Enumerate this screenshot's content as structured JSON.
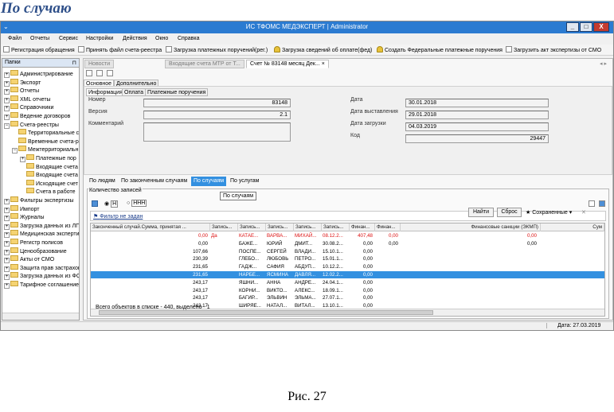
{
  "heading": "По случаю",
  "caption": "Рис. 27",
  "window": {
    "title": "ИС ТФОМС МЕДЭКСПЕРТ | Administrator",
    "app_icon": "chevron-icon",
    "btn_min": "_",
    "btn_max": "□",
    "btn_close": "X"
  },
  "menu": [
    "Файл",
    "Отчеты",
    "Сервис",
    "Настройки",
    "Действия",
    "Окно",
    "Справка"
  ],
  "toolbar": [
    "Регистрация обращения",
    "Принять файл счета-реестра",
    "Загрузка платежных поручений(рег.)",
    "Загрузка сведений об оплате(фед)",
    "Создать Федеральные платежные поручения",
    "Загрузить акт экспертизы от СМО"
  ],
  "left_panel": {
    "title": "Папки",
    "pin": "⊓",
    "items": [
      "Администрирование",
      "Экспорт",
      "Отчеты",
      "XML отчеты",
      "Справочники",
      "Ведение договоров",
      "Счета-реестры",
      "Территориальные с",
      "Временные счета-р",
      "Межтерриториальн",
      "Платежные пор",
      "Входящие счета",
      "Входящие счета",
      "Исходящие счет",
      "Счета в работе",
      "Фильтры экспертизы",
      "Импорт",
      "Журналы",
      "Загрузка данных из ЛП",
      "Медицинская эксперти",
      "Регистр полисов",
      "Ценообразование",
      "Акты от СМО",
      "Защита прав застрахов",
      "Загрузка данных из ФС",
      "Тарифное соглашение"
    ],
    "expand_plus": "+",
    "expand_minus": "−"
  },
  "doc_tabs": [
    "Новости",
    "Входящие счета МТР от Т...",
    "Счет № 83148 месяц Дек..."
  ],
  "doc_tab_close": "×",
  "doc_tab_nav": "◂ ▸",
  "section_tabs": [
    "Основное",
    "Дополнительно"
  ],
  "info_tabs": [
    "Информация",
    "Оплата",
    "Платежные поручения"
  ],
  "form": {
    "number_label": "Номер",
    "number": "83148",
    "version_label": "Версия",
    "version": "2.1",
    "comment_label": "Комментарий",
    "date_label": "Дата",
    "date": "30.01.2018",
    "issued_label": "Дата выставления",
    "issued": "29.01.2018",
    "loaded_label": "Дата загрузки",
    "loaded": "04.03.2019",
    "code_label": "Код",
    "code": "29447"
  },
  "view_tabs": [
    "По людям",
    "По законченным случаям",
    "По случаям",
    "По услугам"
  ],
  "tooltip": "По случаям",
  "grid": {
    "count_label": "Количество записей",
    "radio_a": "Н",
    "radio_b": "ННН",
    "filter_text": "Фильтр не задан",
    "find_btn": "Найти",
    "reset_btn": "Сброс",
    "saved_btn": "Сохраненные",
    "columns": [
      "Законченный случай.Сумма, принятая ...",
      "Запись...",
      "Запись...",
      "Запись...",
      "Запись...",
      "Запись...",
      "Финан...",
      "Финан...",
      "Финансовые санкции (ЭКМП)",
      "Сум"
    ],
    "rows": [
      {
        "sum": "0,00",
        "a": "Да",
        "fam": "КАТАЕ...",
        "name": "ВАРВА...",
        "otch": "МИХАЙ...",
        "dob": "08.12.2...",
        "f1": "407,48",
        "f2": "0,00",
        "ekmp": "0,00",
        "red": true,
        "sel": false
      },
      {
        "sum": "0,00",
        "a": "",
        "fam": "БАЖЕ...",
        "name": "ЮРИЙ",
        "otch": "ДМИТ...",
        "dob": "30.08.2...",
        "f1": "0,00",
        "f2": "0,00",
        "ekmp": "0,00",
        "red": false,
        "sel": false
      },
      {
        "sum": "107,66",
        "a": "",
        "fam": "ПОСПЕ...",
        "name": "СЕРГЕЙ",
        "otch": "ВЛАДИ...",
        "dob": "15.10.1...",
        "f1": "0,00",
        "f2": "",
        "ekmp": "",
        "red": false,
        "sel": false
      },
      {
        "sum": "230,39",
        "a": "",
        "fam": "ГЛЕБО...",
        "name": "ЛЮБОВЬ",
        "otch": "ПЕТРО...",
        "dob": "15.01.1...",
        "f1": "0,00",
        "f2": "",
        "ekmp": "",
        "red": false,
        "sel": false
      },
      {
        "sum": "231,65",
        "a": "",
        "fam": "ГАДЖ...",
        "name": "САФИЯ",
        "otch": "АБДУП...",
        "dob": "10.12.2...",
        "f1": "0,00",
        "f2": "",
        "ekmp": "",
        "red": false,
        "sel": false
      },
      {
        "sum": "231,65",
        "a": "",
        "fam": "НАРБЕ...",
        "name": "ЯСМИНА",
        "otch": "ДАВЛЯ...",
        "dob": "12.02.2...",
        "f1": "0,00",
        "f2": "",
        "ekmp": "",
        "red": false,
        "sel": true
      },
      {
        "sum": "243,17",
        "a": "",
        "fam": "ЯШНИ...",
        "name": "АННА",
        "otch": "АНДРЕ...",
        "dob": "24.04.1...",
        "f1": "0,00",
        "f2": "",
        "ekmp": "",
        "red": false,
        "sel": false
      },
      {
        "sum": "243,17",
        "a": "",
        "fam": "КОРНИ...",
        "name": "ВИКТО...",
        "otch": "АЛЕКС...",
        "dob": "18.09.1...",
        "f1": "0,00",
        "f2": "",
        "ekmp": "",
        "red": false,
        "sel": false
      },
      {
        "sum": "243,17",
        "a": "",
        "fam": "БАГИР...",
        "name": "ЭЛЬВИН",
        "otch": "ЭЛЬМА...",
        "dob": "27.07.1...",
        "f1": "0,00",
        "f2": "",
        "ekmp": "",
        "red": false,
        "sel": false
      },
      {
        "sum": "243,17",
        "a": "",
        "fam": "ШИРЯЕ...",
        "name": "НАТАЛ...",
        "otch": "ВИТАЛ...",
        "dob": "13.10.1...",
        "f1": "0,00",
        "f2": "",
        "ekmp": "",
        "red": false,
        "sel": false
      }
    ],
    "footer": "Всего объектов в списке - 440, выделено - 1"
  },
  "status": {
    "date": "Дата: 27.03.2019"
  },
  "colors": {
    "titlebar": "#2b7bd1",
    "selection": "#3390e0",
    "heading": "#2e4f89",
    "error_text": "#dd1111"
  }
}
